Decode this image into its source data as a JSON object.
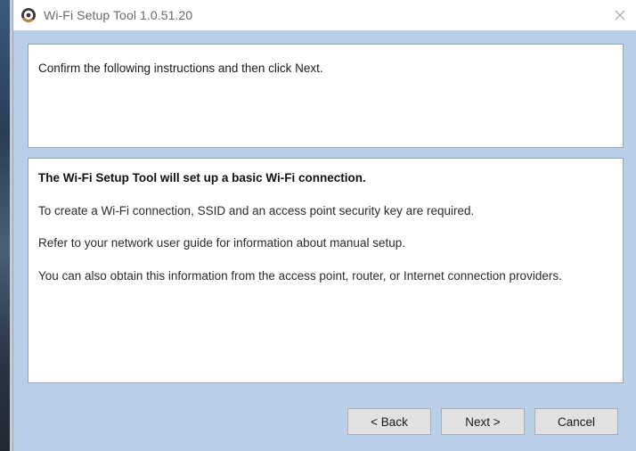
{
  "window": {
    "title": "Wi-Fi Setup Tool 1.0.51.20"
  },
  "top_panel": {
    "instruction": "Confirm the following instructions and then click Next."
  },
  "main_panel": {
    "heading": "The Wi-Fi Setup Tool will set up a basic Wi-Fi connection.",
    "paragraphs": [
      "To create a Wi-Fi connection, SSID and an access point security key are required.",
      "Refer to your network user guide for information about manual setup.",
      "You can also obtain this information from the access point, router, or Internet connection providers."
    ]
  },
  "buttons": {
    "back": "< Back",
    "next": "Next >",
    "cancel": "Cancel"
  },
  "icons": {
    "app": "wifi-setup-app-icon",
    "close": "close-icon"
  },
  "colors": {
    "client_background": "#b9cfe8",
    "panel_border": "#8ea3bc",
    "button_face": "#e1e1e1"
  }
}
